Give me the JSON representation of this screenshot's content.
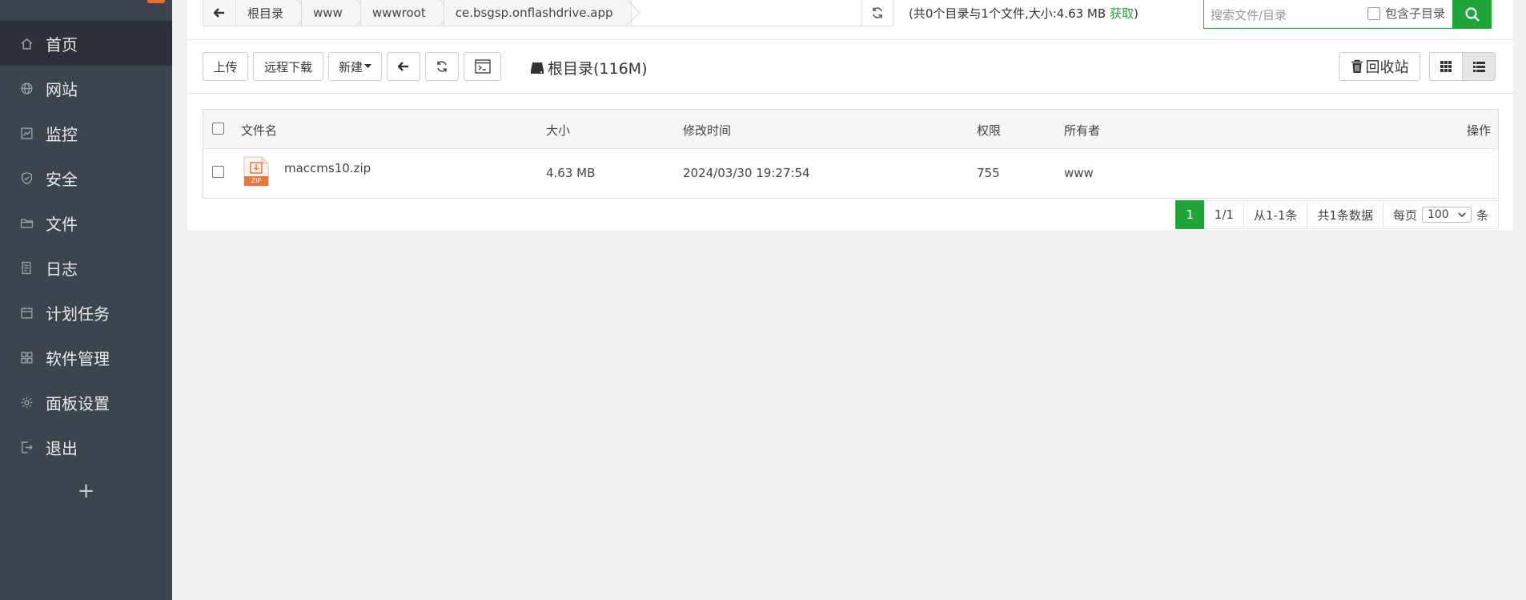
{
  "sidebar": {
    "items": [
      {
        "label": "首页",
        "icon": "home-icon"
      },
      {
        "label": "网站",
        "icon": "globe-icon"
      },
      {
        "label": "监控",
        "icon": "monitor-icon"
      },
      {
        "label": "安全",
        "icon": "shield-icon"
      },
      {
        "label": "文件",
        "icon": "folder-icon"
      },
      {
        "label": "日志",
        "icon": "log-icon"
      },
      {
        "label": "计划任务",
        "icon": "calendar-icon"
      },
      {
        "label": "软件管理",
        "icon": "apps-icon"
      },
      {
        "label": "面板设置",
        "icon": "gear-icon"
      },
      {
        "label": "退出",
        "icon": "logout-icon"
      }
    ],
    "add_label": "+"
  },
  "path": {
    "crumbs": [
      "根目录",
      "www",
      "wwwroot",
      "ce.bsgsp.onflashdrive.app"
    ]
  },
  "summary": {
    "text": "(共0个目录与1个文件,大小:4.63 MB ",
    "get_label": "获取",
    "close": ")"
  },
  "search": {
    "placeholder": "搜索文件/目录",
    "subdir_label": "包含子目录"
  },
  "toolbar": {
    "upload": "上传",
    "remote_download": "远程下载",
    "new": "新建",
    "disk_label": "根目录(116M)",
    "recycle_bin": "回收站"
  },
  "table": {
    "headers": {
      "name": "文件名",
      "size": "大小",
      "mtime": "修改时间",
      "perm": "权限",
      "owner": "所有者",
      "ops": "操作"
    },
    "rows": [
      {
        "name": "maccms10.zip",
        "size": "4.63 MB",
        "mtime": "2024/03/30 19:27:54",
        "perm": "755",
        "owner": "www",
        "file_badge": "ZIP"
      }
    ]
  },
  "pager": {
    "current": "1",
    "pages": "1/1",
    "range": "从1-1条",
    "total": "共1条数据",
    "per_page_prefix": "每页",
    "per_page": "100",
    "per_page_suffix": "条"
  },
  "colors": {
    "accent": "#20a53a",
    "sidebar_bg": "#3c444d",
    "badge": "#f7692d",
    "zip_orange": "#e8773a"
  }
}
